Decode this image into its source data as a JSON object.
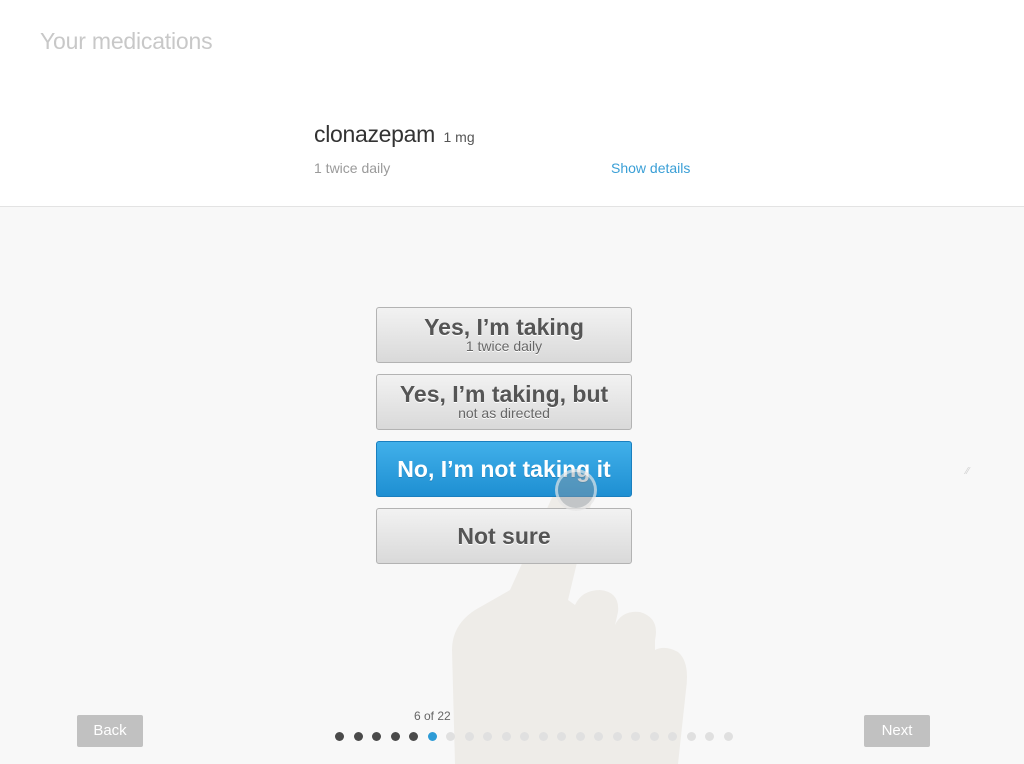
{
  "header": {
    "title": "Your medications"
  },
  "medication": {
    "name": "clonazepam",
    "dose": "1 mg",
    "schedule": "1 twice daily",
    "details_link": "Show details"
  },
  "options": [
    {
      "main": "Yes, I’m taking",
      "sub": "1 twice daily"
    },
    {
      "main": "Yes, I’m taking, but",
      "sub": "not as directed"
    },
    {
      "main": "No, I’m not taking it",
      "sub": ""
    },
    {
      "main": "Not sure",
      "sub": ""
    }
  ],
  "selected_option": "No, I’m not taking it",
  "navigation": {
    "back_label": "Back",
    "next_label": "Next",
    "progress_text": "6 of 22",
    "current_step": 6,
    "total_steps": 22
  },
  "colors": {
    "accent": "#2d9bd6",
    "button_disabled": "#c1c1c1"
  }
}
